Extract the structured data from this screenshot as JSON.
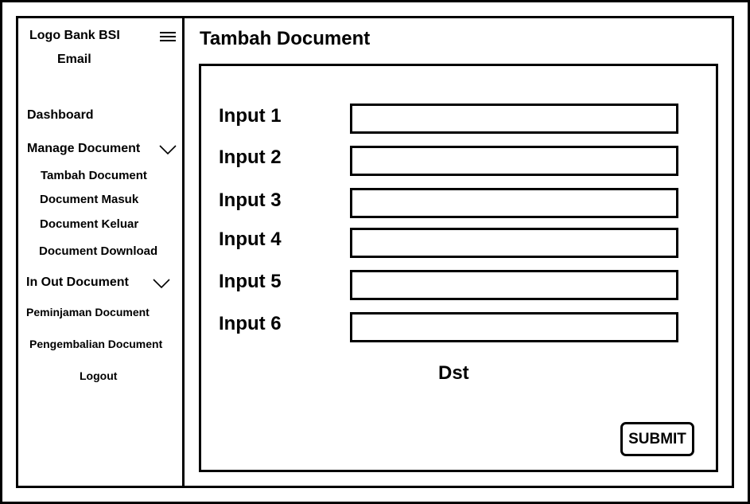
{
  "sidebar": {
    "logo_text": "Logo Bank BSI",
    "email_text": "Email",
    "menu_icon": "hamburger-menu-icon",
    "dashboard_label": "Dashboard",
    "manage_document": {
      "label": "Manage Document",
      "icon": "chevron-down-icon",
      "items": [
        "Tambah Document",
        "Document Masuk",
        "Document Keluar",
        "Document Download"
      ]
    },
    "in_out_document": {
      "label": "In Out Document",
      "icon": "chevron-down-icon",
      "items": [
        "Peminjaman Document",
        "Pengembalian Document"
      ]
    },
    "logout_label": "Logout"
  },
  "main": {
    "title": "Tambah Document",
    "form": {
      "fields": [
        {
          "label": "Input 1",
          "value": ""
        },
        {
          "label": "Input 2",
          "value": ""
        },
        {
          "label": "Input 3",
          "value": ""
        },
        {
          "label": "Input 4",
          "value": ""
        },
        {
          "label": "Input 5",
          "value": ""
        },
        {
          "label": "Input 6",
          "value": ""
        }
      ],
      "more_text": "Dst",
      "submit_label": "SUBMIT"
    }
  }
}
